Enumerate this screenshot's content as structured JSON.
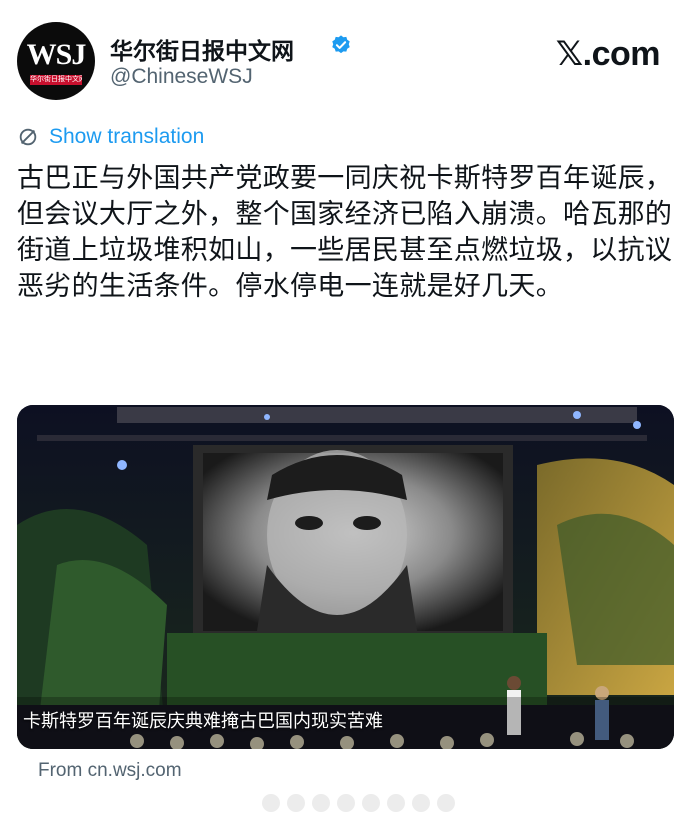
{
  "header": {
    "avatar_text": "WSJ",
    "avatar_sub": "华尔街日报中文网",
    "display_name": "华尔街日报中文网",
    "handle": "@ChineseWSJ",
    "site": "𝕏.com"
  },
  "translation": {
    "label": "Show translation"
  },
  "post": {
    "text": "古巴正与外国共产党政要一同庆祝卡斯特罗百年诞辰，但会议大厅之外，整个国家经济已陷入崩溃。哈瓦那的街道上垃圾堆积如山，一些居民甚至点燃垃圾，以抗议恶劣的生活条件。停水停电一连就是好几天。"
  },
  "media": {
    "caption": "卡斯特罗百年诞辰庆典难掩古巴国内现实苦难"
  },
  "card": {
    "source": "From cn.wsj.com"
  },
  "colors": {
    "accent": "#1d9bf0",
    "muted": "#536471",
    "text": "#0f1419"
  }
}
